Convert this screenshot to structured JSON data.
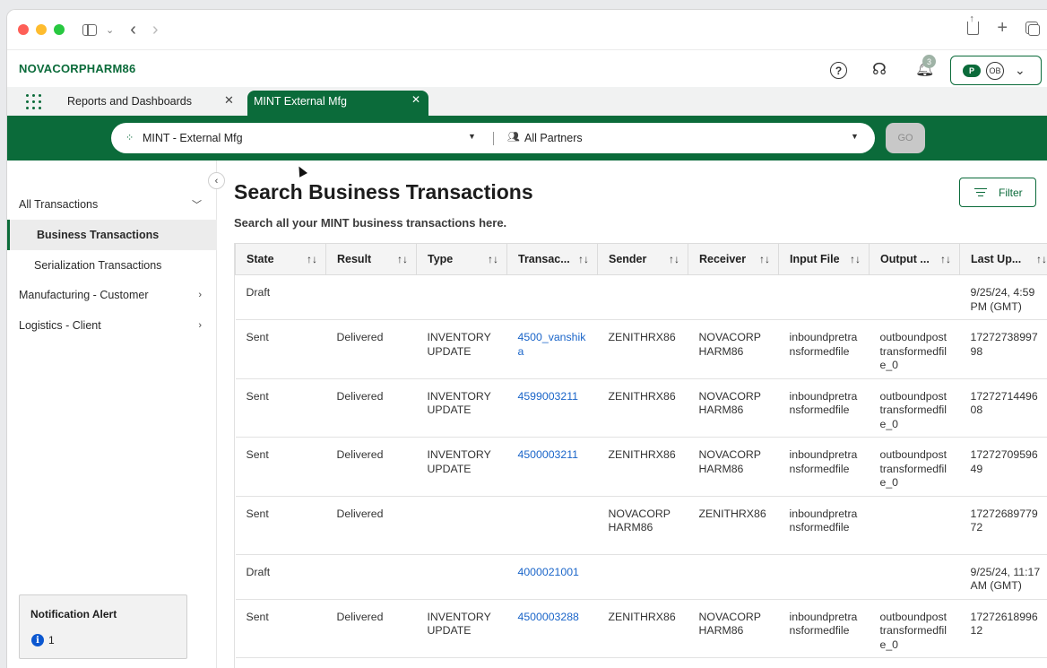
{
  "browser": {
    "back_icon": "chevron-left-icon",
    "forward_icon": "chevron-right-icon"
  },
  "header": {
    "brand": "NOVACORPHARM86",
    "notification_count": "3",
    "user_initials": "OB",
    "cloud_letter": "P"
  },
  "tabs": [
    {
      "label": "Reports and Dashboards"
    },
    {
      "label": "MINT External Mfg"
    }
  ],
  "search": {
    "company": "MINT - External Mfg",
    "partners": "All Partners",
    "go_label": "GO"
  },
  "sidebar": {
    "items": [
      {
        "label": "All Transactions"
      },
      {
        "label": "Business Transactions"
      },
      {
        "label": "Serialization Transactions"
      },
      {
        "label": "Manufacturing - Customer"
      },
      {
        "label": "Logistics - Client"
      }
    ],
    "notification": {
      "title": "Notification Alert",
      "count": "1"
    }
  },
  "main": {
    "title": "Search Business Transactions",
    "subtitle": "Search all your MINT business transactions here.",
    "filter_label": "Filter"
  },
  "table": {
    "columns": [
      "State",
      "Result",
      "Type",
      "Transac...",
      "Sender",
      "Receiver",
      "Input File",
      "Output ...",
      "Last Up..."
    ],
    "rows": [
      [
        "Draft",
        "",
        "",
        "",
        "",
        "",
        "",
        "",
        "9/25/24, 4:59 PM (GMT)"
      ],
      [
        "Sent",
        "Delivered",
        "INVENTORYUPDATE",
        "4500_vanshika",
        "ZENITHRX86",
        "NOVACORPHARM86",
        "inboundpretransformedfile",
        "outboundposttransformedfile_0",
        "1727273899798"
      ],
      [
        "Sent",
        "Delivered",
        "INVENTORYUPDATE",
        "4599003211",
        "ZENITHRX86",
        "NOVACORPHARM86",
        "inboundpretransformedfile",
        "outboundposttransformedfile_0",
        "1727271449608"
      ],
      [
        "Sent",
        "Delivered",
        "INVENTORYUPDATE",
        "4500003211",
        "ZENITHRX86",
        "NOVACORPHARM86",
        "inboundpretransformedfile",
        "outboundposttransformedfile_0",
        "1727270959649"
      ],
      [
        "Sent",
        "Delivered",
        "",
        "",
        "NOVACORPHARM86",
        "ZENITHRX86",
        "inboundpretransformedfile",
        "",
        "1727268977972"
      ],
      [
        "Draft",
        "",
        "",
        "4000021001",
        "",
        "",
        "",
        "",
        "9/25/24, 11:17 AM (GMT)"
      ],
      [
        "Sent",
        "Delivered",
        "INVENTORYUPDATE",
        "4500003288",
        "ZENITHRX86",
        "NOVACORPHARM86",
        "inboundpretransformedfile",
        "outboundposttransformedfile_0",
        "1727261899612"
      ],
      [
        "",
        "",
        "",
        "",
        "",
        "",
        "",
        "",
        ""
      ]
    ]
  },
  "colors": {
    "brand_green": "#0b6b3a",
    "link_blue": "#1a65c9"
  }
}
